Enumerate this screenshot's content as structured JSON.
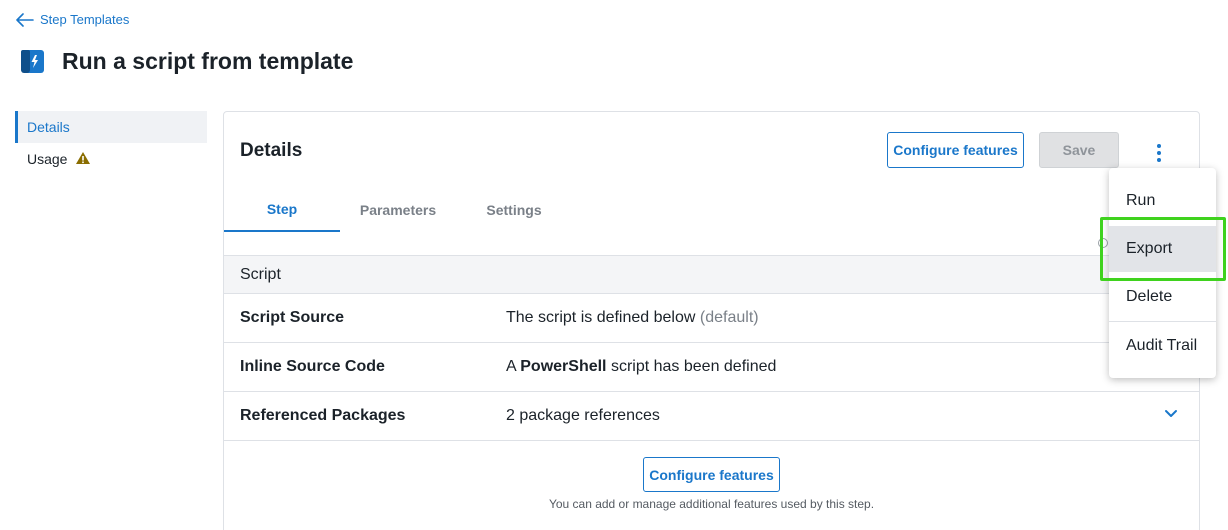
{
  "breadcrumb": {
    "back_label": "Step Templates"
  },
  "page": {
    "title": "Run a script from template"
  },
  "side_nav": {
    "items": [
      {
        "label": "Details",
        "active": true
      },
      {
        "label": "Usage",
        "warning": true
      }
    ]
  },
  "card": {
    "title": "Details",
    "configure_label": "Configure features",
    "save_label": "Save",
    "tabs": [
      "Step",
      "Parameters",
      "Settings"
    ],
    "section_title": "Script",
    "rows": [
      {
        "label": "Script Source",
        "value": "The script is defined below",
        "value_suffix": "(default)"
      },
      {
        "label": "Inline Source Code",
        "value_prefix": "A",
        "value_bold": "PowerShell",
        "value": "script has been defined"
      },
      {
        "label": "Referenced Packages",
        "value": "2 package references"
      }
    ],
    "footer_button": "Configure features",
    "footer_note": "You can add or manage additional features used by this step."
  },
  "menu": {
    "items": [
      "Run",
      "Export",
      "Delete",
      "Audit Trail"
    ],
    "highlighted": "Export"
  },
  "colors": {
    "accent": "#1a77ca",
    "warning": "#8a6d00",
    "highlight": "#3fd21e"
  }
}
